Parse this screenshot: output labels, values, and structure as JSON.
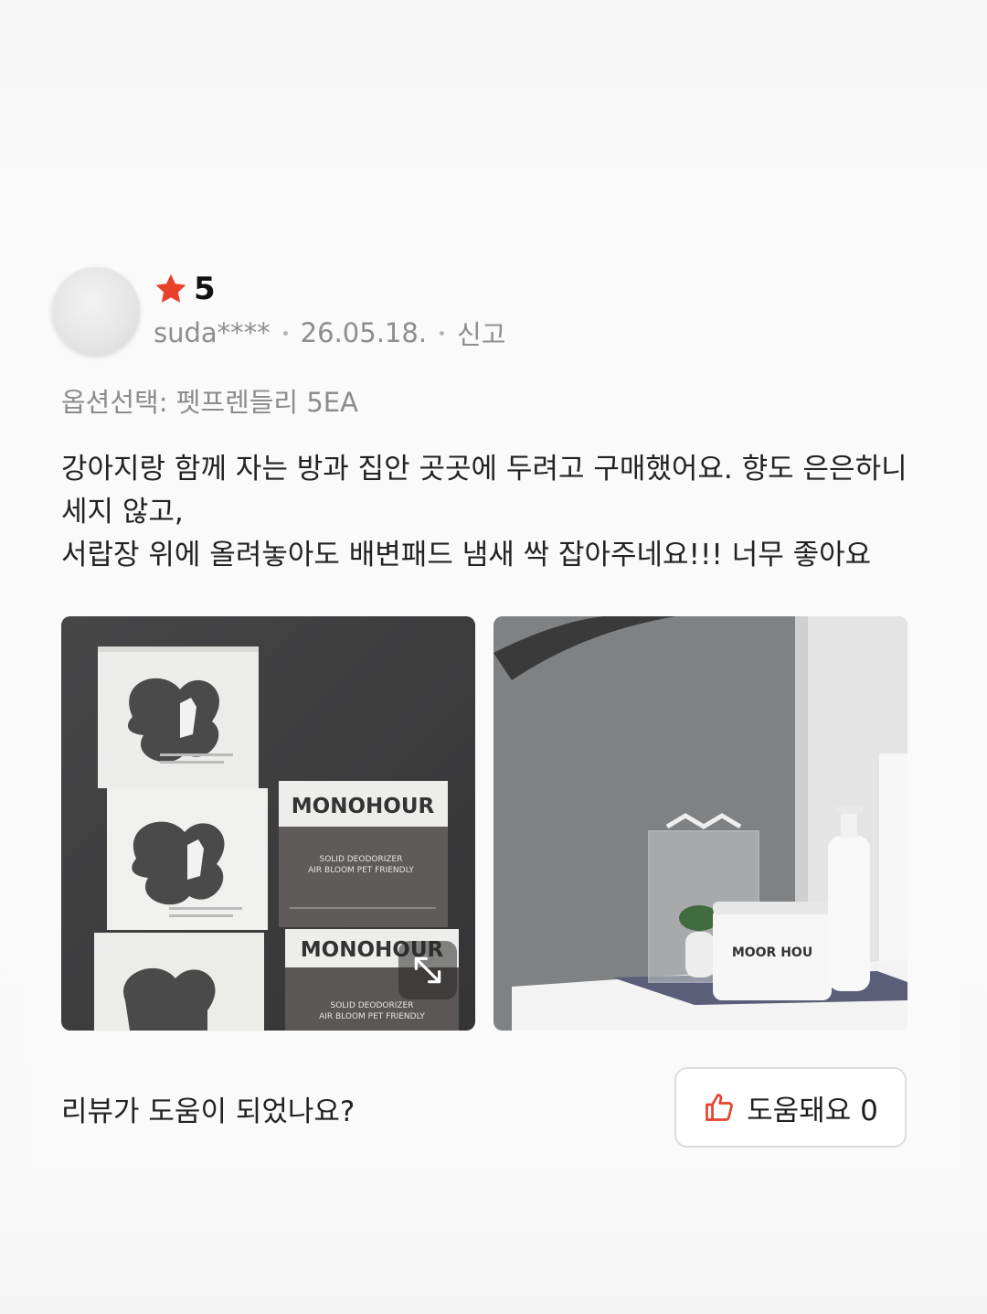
{
  "review": {
    "rating": "5",
    "star_color": "#e8412c",
    "author": "suda****",
    "date": "26.05.18.",
    "report_label": "신고",
    "option": "옵션선택: 펫프렌들리 5EA",
    "body_lines": [
      "강아지랑 함께 자는 방과 집안 곳곳에 두려고 구매했어요. 향도 은은하니",
      "세지 않고,",
      "서랍장 위에 올려놓아도 배변패드 냄새 싹 잡아주네요!!! 너무 좋아요"
    ]
  },
  "photos": [
    {
      "name": "product-boxes-photo",
      "brand": "MONOHOUR",
      "subtitle1": "SOLID DEODORIZER",
      "subtitle2": "AIR BLOOM PET FRIENDLY",
      "expand_icon": "expand-icon"
    },
    {
      "name": "product-on-shelf-photo",
      "jar_label": "MOOR HOU"
    }
  ],
  "helpful": {
    "question": "리뷰가 도움이 되었나요?",
    "button_label": "도움돼요 0",
    "icon": "thumbs-up-icon",
    "icon_color": "#e8412c"
  }
}
